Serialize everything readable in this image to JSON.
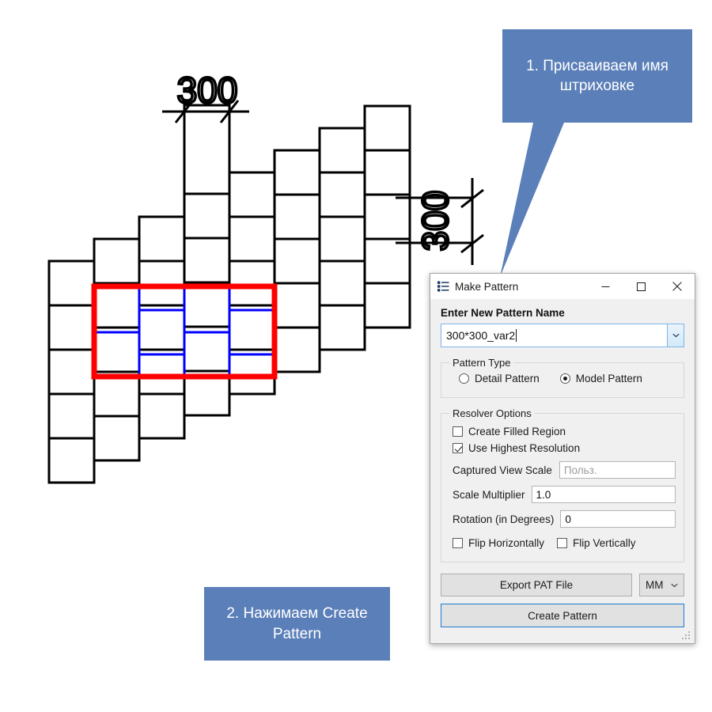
{
  "callouts": [
    {
      "id": "callout-1",
      "text": "1. Присваиваем имя штриховке",
      "color": "#5b7fb9"
    },
    {
      "id": "callout-2",
      "text": "2. Нажимаем Create Pattern",
      "color": "#5b7fb9"
    }
  ],
  "drawing": {
    "dimension_horizontal": "300",
    "dimension_vertical": "300",
    "line_color": "#000000",
    "pattern_highlight_color": "#0000ff",
    "selection_box_color": "#ff0000"
  },
  "dialog": {
    "title": "Make Pattern",
    "icon": "list-icon",
    "window_buttons": {
      "minimize": "minimize-icon",
      "maximize": "maximize-icon",
      "close": "close-icon"
    },
    "pattern_name": {
      "label": "Enter New Pattern Name",
      "value": "300*300_var2",
      "dropdown_icon": "chevron-down-icon"
    },
    "pattern_type": {
      "legend": "Pattern Type",
      "options": [
        {
          "label": "Detail Pattern",
          "selected": false
        },
        {
          "label": "Model Pattern",
          "selected": true
        }
      ]
    },
    "resolver_options": {
      "legend": "Resolver Options",
      "checkboxes": [
        {
          "label": "Create Filled Region",
          "checked": false
        },
        {
          "label": "Use Highest Resolution",
          "checked": true
        }
      ],
      "fields": [
        {
          "label": "Captured View Scale",
          "value": "",
          "placeholder": "Польз."
        },
        {
          "label": "Scale Multiplier",
          "value": "1.0",
          "placeholder": ""
        },
        {
          "label": "Rotation (in Degrees)",
          "value": "0",
          "placeholder": ""
        }
      ],
      "flip_options": [
        {
          "label": "Flip Horizontally",
          "checked": false
        },
        {
          "label": "Flip Vertically",
          "checked": false
        }
      ]
    },
    "buttons": {
      "export": "Export PAT File",
      "units": "MM",
      "units_icon": "chevron-down-icon",
      "create": "Create Pattern"
    }
  }
}
